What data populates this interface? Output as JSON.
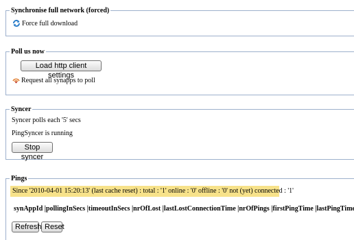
{
  "sync": {
    "legend": "Synchronise full network (forced)",
    "force_link": "Force full download",
    "force_icon": "refresh-icon"
  },
  "poll": {
    "legend": "Poll us now",
    "load_button": "Load http client settings",
    "request_link": "Request all synapps to poll",
    "request_icon": "broadcast-icon"
  },
  "syncer": {
    "legend": "Syncer",
    "interval_text": "Syncer polls each '5' secs",
    "status_text": "PingSyncer is running",
    "stop_button": "Stop syncer"
  },
  "pings": {
    "legend": "Pings",
    "summary": "Since '2010-04-01 15:20:13' (last cache reset) : total : '1' online : '0' offline : '0' not (yet) connected : '1'",
    "columns": "synAppId |pollingInSecs |timeoutInSecs |nrOfLost |lastLostConnectionTime |nrOfPings |firstPingTime |lastPingTime",
    "refresh_button": "Refresh",
    "reset_button": "Reset"
  },
  "colors": {
    "border": "#9cb0cc",
    "highlight": "#f7e28a"
  }
}
